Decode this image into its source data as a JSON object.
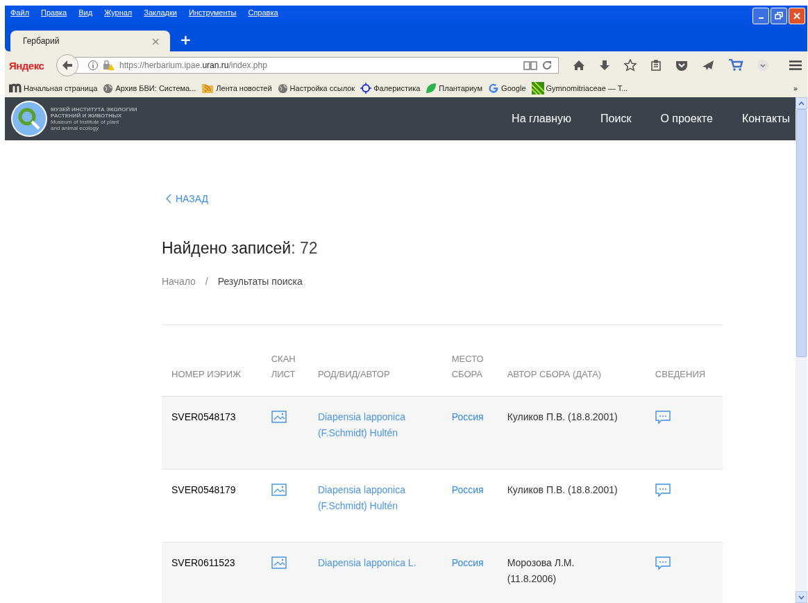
{
  "menu": [
    "Файл",
    "Правка",
    "Вид",
    "Журнал",
    "Закладки",
    "Инструменты",
    "Справка"
  ],
  "tabs": [
    {
      "label": "Гербарий",
      "selected": true,
      "close": "×"
    }
  ],
  "new_tab": "+",
  "brand": "Яндекс",
  "url": {
    "prefix": "https://herbarium.ipae.",
    "host": "uran.ru",
    "suffix": "/index.php"
  },
  "bookmarks": [
    "Начальная страница",
    "Архив БВИ: Система...",
    "Лента новостей",
    "Настройка ссылок",
    "Фалеристика",
    "Плантариум",
    "Google",
    "Gymnomitriaceae — T..."
  ],
  "bookmarks_more": "»",
  "site": {
    "logo_title_1": "МУЗЕЙ ИНСТИТУТА ЭКОЛОГИИ",
    "logo_title_2": "РАСТЕНИЙ И ЖИВОТНЫХ",
    "logo_sub_1": "Museum of Institute of plant",
    "logo_sub_2": "and animal ecology",
    "nav": [
      "На главную",
      "Поиск",
      "О проекте",
      "Контакты"
    ]
  },
  "back": "НАЗАД",
  "heading": {
    "label": "Найдено записей",
    "count": ": 72"
  },
  "breadcrumbs": [
    "Начало",
    "Результаты поиска"
  ],
  "breadcrumb_sep": "/",
  "table": {
    "columns": [
      [
        "НОМЕР ИЭРИЖ"
      ],
      [
        "СКАН",
        "ЛИСТ"
      ],
      [
        "РОД/ВИД/АВТОР"
      ],
      [
        "МЕСТО",
        "СБОРА"
      ],
      [
        "АВТОР СБОРА (ДАТА)"
      ],
      [
        "СВЕДЕНИЯ"
      ]
    ],
    "rows": [
      {
        "id": "SVER0548173",
        "taxon": [
          "Diapensia lapponica",
          "(F.Schmidt) Hultén"
        ],
        "place": "Россия",
        "collector": [
          "Куликов П.В. (18.8.2001)"
        ]
      },
      {
        "id": "SVER0548179",
        "taxon": [
          "Diapensia lapponica",
          "(F.Schmidt) Hultén"
        ],
        "place": "Россия",
        "collector": [
          "Куликов П.В. (18.8.2001)"
        ]
      },
      {
        "id": "SVER0611523",
        "taxon": [
          "Diapensia lapponica L."
        ],
        "place": "Россия",
        "collector": [
          "Морозова Л.М.",
          "(11.8.2006)"
        ]
      }
    ]
  }
}
